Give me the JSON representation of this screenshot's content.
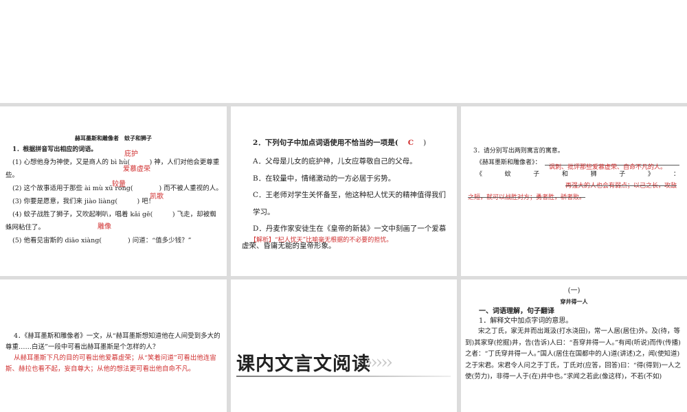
{
  "slide1": {
    "title": "赫耳墨斯和雕像者　蚊子和狮子",
    "q": "1．根据拼音写出相应的词语。",
    "lines": [
      "(1) 心想他身为神使，又是商人的 bì hù(　　　) 神，人们对他会更尊重些。",
      "(2) 这个故事适用于那些 ài mù xū róng(　　　　) 而不被人重视的人。",
      "(3) 你要是愿意，我们来 jiào liàng(　　　) 吧！",
      "(4) 蚊子战胜了狮子，又吹起喇叭，唱着 kǎi gē(　　　) 飞走，却被蜘蛛网粘住了。",
      "(5) 他看见宙斯的 diāo xiàng(　　　　) 问道：“值多少钱？”"
    ],
    "answers": [
      "庇护",
      "爱慕虚荣",
      "较量",
      "凯歌",
      "雕像"
    ]
  },
  "slide2": {
    "q": "2．下列句子中加点词语使用不恰当的一项是(",
    "answer": "C",
    "close": ")",
    "options": [
      "A．父母是儿女的庇护神，儿女应尊敬自己的父母。",
      "B．在较量中，情绪激动的一方必居于劣势。",
      "C．王老师对学生关怀备至，他这种杞人忧天的精神值得我们学习。",
      "D．丹麦作家安徒生在《皇帝的新装》一文中刻画了一个爱慕虚荣、昏庸无能的皇帝形象。"
    ],
    "analysis": "【解析】“杞人忧天”比喻毫无根据的不必要的担忧。"
  },
  "slide3": {
    "q": "3．请分别写出两则寓言的寓意。",
    "label1": "《赫耳墨斯和雕像者》：",
    "answer1": "讽刺、批评那些爱慕虚荣、自命不凡的人。",
    "label2": "《　蚊　子　和　狮　子　》　：",
    "answer2": "再强大的人也会有弱点；以己之长，攻敌之短，就可以战胜对方；勇者胜，骄者败。"
  },
  "slide4": {
    "q": "4．《赫耳墨斯和雕像者》一文，从“赫耳墨斯想知道他在人间受到多大的尊重……白送”一段中可看出赫耳墨斯是个怎样的人？",
    "answer": "从赫耳墨斯下凡的目的可看出他爱慕虚荣；从“笑着问道”可看出他连宙斯、赫拉也看不起，妄自尊大；从他的想法更可看出他自命不凡。"
  },
  "slide5": {
    "banner": "课内文言文阅读"
  },
  "slide6": {
    "num": "(一)",
    "title": "穿井得一人",
    "section": "一、词语理解，句子翻译",
    "q": "1．解释文中加点字词的意思。",
    "text": "宋之丁氏，家无井而出溉汲(打水浇田)，常一人居(居住)外。及(待，等到)其家穿(挖掘)井，告(告诉)人曰：“吾穿井得一人。”有闻(听说)而传(传播)之者：“丁氏穿井得一人。”国人(居住在国都中的人)道(讲述)之，闻(使知道)之于宋君。宋君令人问之于丁氏，丁氏对(应答，回答)曰：“得(得到)一人之使(劳力)，非得一人于(在)井中也。”求闻之若此(像这样)，不若(不如)"
  }
}
